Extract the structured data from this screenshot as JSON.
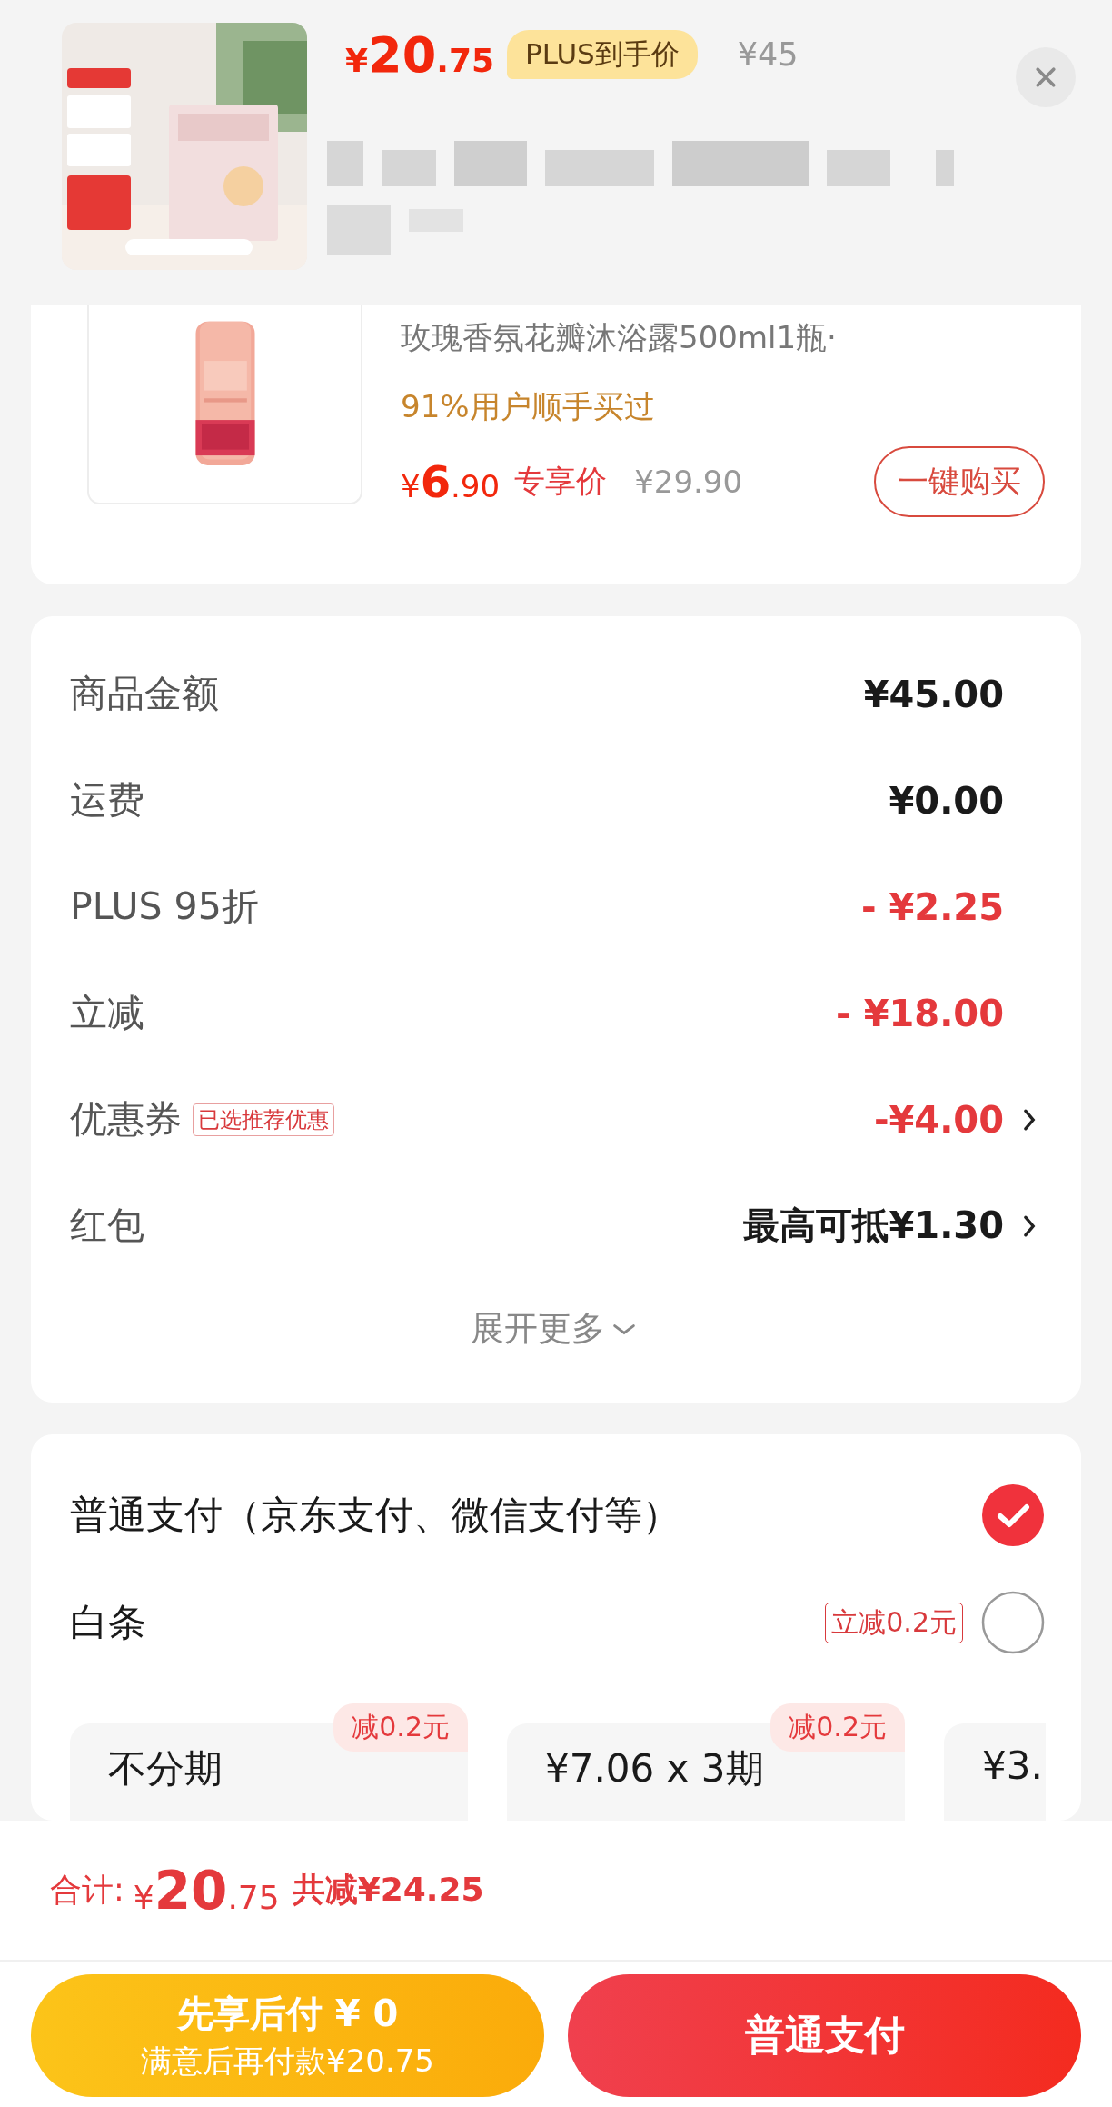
{
  "header": {
    "price": "¥20.75",
    "badge": "PLUS到手价",
    "original_price": "¥45"
  },
  "product": {
    "title": "玫瑰香氛花瓣沐浴露500ml1瓶·",
    "note": "91%用户顺手买过",
    "price": "¥6.90",
    "price_label": "专享价",
    "original_price": "¥29.90",
    "buy_button": "一键购买"
  },
  "summary": {
    "rows": [
      {
        "label": "商品金额",
        "value": "¥45.00",
        "kind": "plain",
        "link": false
      },
      {
        "label": "运费",
        "value": "¥0.00",
        "kind": "plain",
        "link": false
      },
      {
        "label": "PLUS 95折",
        "value": "- ¥2.25",
        "kind": "discount",
        "link": false
      },
      {
        "label": "立减",
        "value": "- ¥18.00",
        "kind": "discount",
        "link": false
      },
      {
        "label": "优惠券",
        "tag": "已选推荐优惠",
        "value": "-¥4.00",
        "kind": "discount",
        "link": true
      },
      {
        "label": "红包",
        "value": "最高可抵¥1.30",
        "kind": "plain",
        "link": true
      }
    ],
    "expand": "展开更多"
  },
  "payment": {
    "options": [
      {
        "label": "普通支付（京东支付、微信支付等）",
        "selected": true
      },
      {
        "label": "白条",
        "tag": "立减0.2元",
        "selected": false
      }
    ],
    "plans": [
      {
        "badge": "减0.2元",
        "title": "不分期"
      },
      {
        "badge": "减0.2元",
        "title": "¥7.06 x 3期"
      },
      {
        "title": "¥3."
      }
    ]
  },
  "footer": {
    "total_label": "合计:",
    "total": "¥20.75",
    "saved": "共减¥24.25",
    "later_button": {
      "title": "先享后付 ¥ 0",
      "subtitle": "满意后再付款¥20.75"
    },
    "pay_button": "普通支付"
  }
}
